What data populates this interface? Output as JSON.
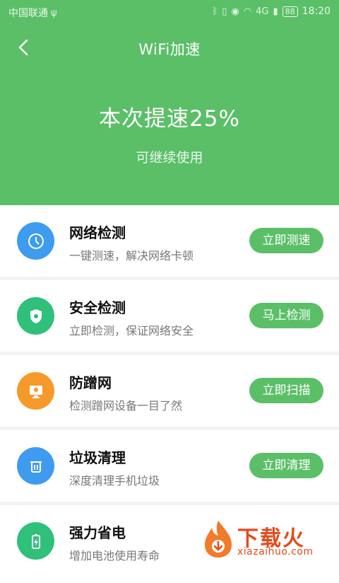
{
  "status_bar": {
    "carrier": "中国联通",
    "time": "18:20",
    "battery": "88",
    "network": "4G"
  },
  "header": {
    "title": "WiFi加速",
    "headline": "本次提速25%",
    "subline": "可继续使用"
  },
  "items": [
    {
      "title": "网络检测",
      "desc": "一键测速，解决网络卡顿",
      "button": "立即测速",
      "icon": "clock-icon",
      "color": "#3e9bf0"
    },
    {
      "title": "安全检测",
      "desc": "立即检测，保证网络安全",
      "button": "马上检测",
      "icon": "shield-icon",
      "color": "#2fc07a"
    },
    {
      "title": "防蹭网",
      "desc": "检测蹭网设备一目了然",
      "button": "立即扫描",
      "icon": "monitor-icon",
      "color": "#f59a2a"
    },
    {
      "title": "垃圾清理",
      "desc": "深度清理手机垃圾",
      "button": "立即清理",
      "icon": "trash-icon",
      "color": "#3e9bf0"
    },
    {
      "title": "强力省电",
      "desc": "增加电池使用寿命",
      "icon": "battery-icon",
      "color": "#2fc07a"
    }
  ],
  "watermark": {
    "main": "下载火",
    "sub": "xiazaihuo.com"
  }
}
